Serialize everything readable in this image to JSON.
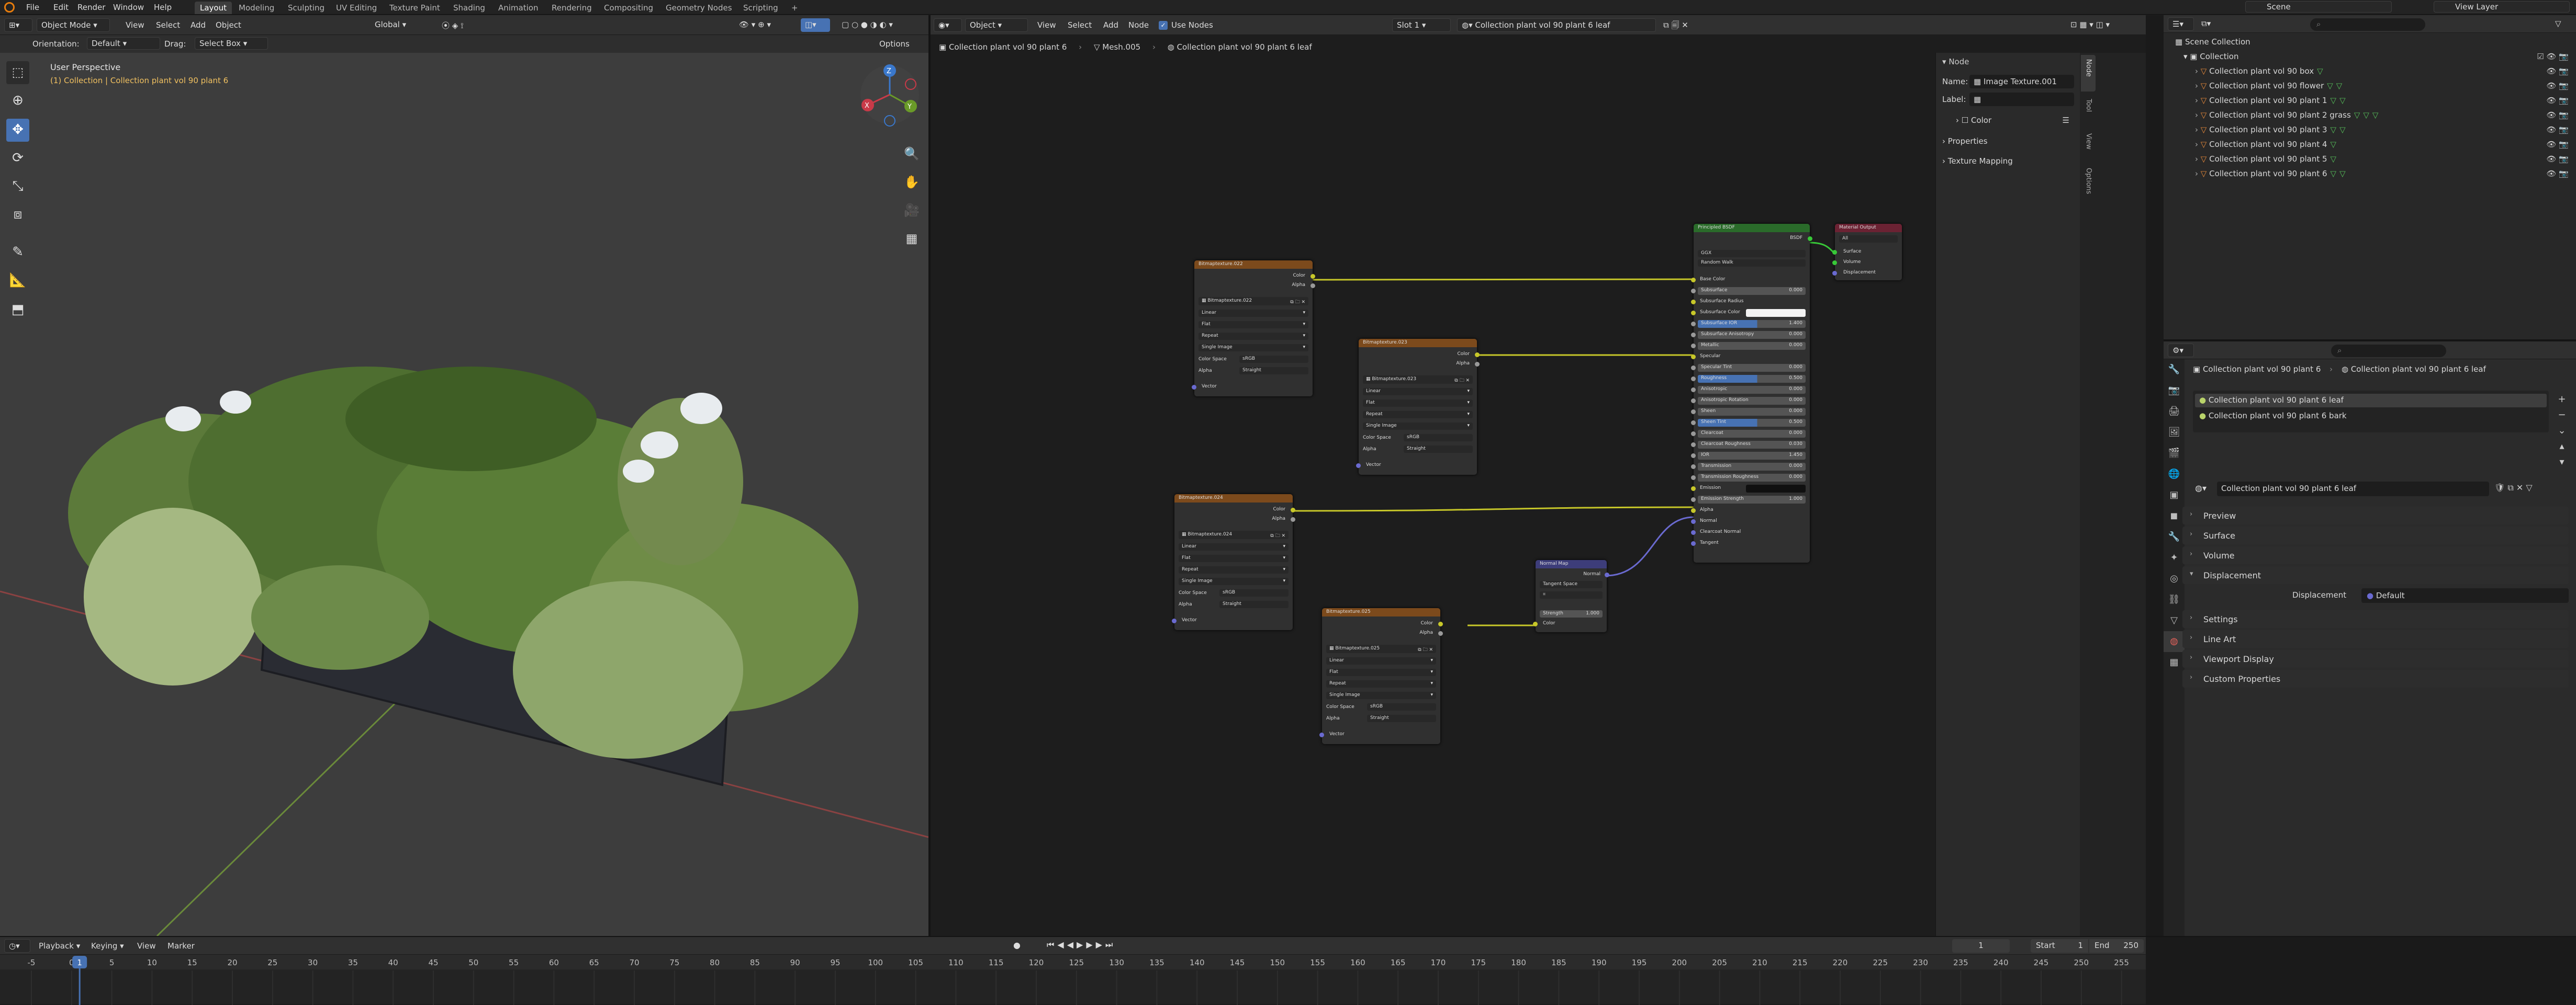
{
  "topbar": {
    "menu": [
      "File",
      "Edit",
      "Render",
      "Window",
      "Help"
    ],
    "workspaces": [
      "Layout",
      "Modeling",
      "Sculpting",
      "UV Editing",
      "Texture Paint",
      "Shading",
      "Animation",
      "Rendering",
      "Compositing",
      "Geometry Nodes",
      "Scripting"
    ],
    "active_workspace": "Layout",
    "add_tab": "+",
    "scene": "Scene",
    "view_layer": "View Layer"
  },
  "viewport": {
    "mode": "Object Mode",
    "menus": [
      "View",
      "Select",
      "Add",
      "Object"
    ],
    "orientation_label": "Orientation:",
    "orientation_value": "Default",
    "drag_label": "Drag:",
    "drag_value": "Select Box",
    "transform_orientation": "Global",
    "options": "Options",
    "overlay_title": "User Perspective",
    "overlay_subtitle": "(1) Collection | Collection plant vol 90 plant 6",
    "gizmo": {
      "x": "X",
      "y": "Y",
      "z": "Z"
    }
  },
  "node_editor": {
    "editor_mode": "Object",
    "menus": [
      "View",
      "Select",
      "Add",
      "Node"
    ],
    "use_nodes_label": "Use Nodes",
    "slot": "Slot 1",
    "material": "Collection plant vol 90 plant 6  leaf",
    "breadcrumb": [
      "Collection plant vol 90 plant 6",
      "Mesh.005",
      "Collection plant vol 90 plant 6  leaf"
    ],
    "image_nodes": [
      {
        "title": "Bitmaptexture.022",
        "image": "Bitmaptexture.022",
        "interp": "Linear",
        "proj": "Flat",
        "ext": "Repeat",
        "source": "Single Image",
        "colorspace_label": "Color Space",
        "colorspace": "sRGB",
        "alpha_label": "Alpha",
        "alpha": "Straight",
        "out_color": "Color",
        "out_alpha": "Alpha",
        "in_vector": "Vector"
      },
      {
        "title": "Bitmaptexture.023",
        "image": "Bitmaptexture.023",
        "interp": "Linear",
        "proj": "Flat",
        "ext": "Repeat",
        "source": "Single Image",
        "colorspace_label": "Color Space",
        "colorspace": "sRGB",
        "alpha_label": "Alpha",
        "alpha": "Straight",
        "out_color": "Color",
        "out_alpha": "Alpha",
        "in_vector": "Vector"
      },
      {
        "title": "Bitmaptexture.024",
        "image": "Bitmaptexture.024",
        "interp": "Linear",
        "proj": "Flat",
        "ext": "Repeat",
        "source": "Single Image",
        "colorspace_label": "Color Space",
        "colorspace": "sRGB",
        "alpha_label": "Alpha",
        "alpha": "Straight",
        "out_color": "Color",
        "out_alpha": "Alpha",
        "in_vector": "Vector"
      },
      {
        "title": "Bitmaptexture.025",
        "image": "Bitmaptexture.025",
        "interp": "Linear",
        "proj": "Flat",
        "ext": "Repeat",
        "source": "Single Image",
        "colorspace_label": "Color Space",
        "colorspace": "sRGB",
        "alpha_label": "Alpha",
        "alpha": "Straight",
        "out_color": "Color",
        "out_alpha": "Alpha",
        "in_vector": "Vector"
      }
    ],
    "normal_map": {
      "title": "Normal Map",
      "out": "Normal",
      "space": "Tangent Space",
      "uv": "",
      "strength_label": "Strength",
      "strength": "1.000",
      "in_color": "Color"
    },
    "bsdf": {
      "title": "Principled BSDF",
      "output": "BSDF",
      "dist": "GGX",
      "sss": "Random Walk",
      "rows": [
        {
          "label": "Base Color",
          "value": "",
          "kind": "plain"
        },
        {
          "label": "Subsurface",
          "value": "0.000",
          "kind": "field"
        },
        {
          "label": "Subsurface Radius",
          "value": "",
          "kind": "plain"
        },
        {
          "label": "Subsurface Color",
          "value": "",
          "kind": "swatch"
        },
        {
          "label": "Subsurface IOR",
          "value": "1.400",
          "kind": "blue"
        },
        {
          "label": "Subsurface Anisotropy",
          "value": "0.000",
          "kind": "field"
        },
        {
          "label": "Metallic",
          "value": "0.000",
          "kind": "field"
        },
        {
          "label": "Specular",
          "value": "",
          "kind": "plain"
        },
        {
          "label": "Specular Tint",
          "value": "0.000",
          "kind": "field"
        },
        {
          "label": "Roughness",
          "value": "0.500",
          "kind": "blue"
        },
        {
          "label": "Anisotropic",
          "value": "0.000",
          "kind": "field"
        },
        {
          "label": "Anisotropic Rotation",
          "value": "0.000",
          "kind": "field"
        },
        {
          "label": "Sheen",
          "value": "0.000",
          "kind": "field"
        },
        {
          "label": "Sheen Tint",
          "value": "0.500",
          "kind": "blue"
        },
        {
          "label": "Clearcoat",
          "value": "0.000",
          "kind": "field"
        },
        {
          "label": "Clearcoat Roughness",
          "value": "0.030",
          "kind": "field"
        },
        {
          "label": "IOR",
          "value": "1.450",
          "kind": "field"
        },
        {
          "label": "Transmission",
          "value": "0.000",
          "kind": "field"
        },
        {
          "label": "Transmission Roughness",
          "value": "0.000",
          "kind": "field"
        },
        {
          "label": "Emission",
          "value": "",
          "kind": "dark"
        },
        {
          "label": "Emission Strength",
          "value": "1.000",
          "kind": "field"
        },
        {
          "label": "Alpha",
          "value": "",
          "kind": "plain"
        },
        {
          "label": "Normal",
          "value": "",
          "kind": "plain"
        },
        {
          "label": "Clearcoat Normal",
          "value": "",
          "kind": "plain"
        },
        {
          "label": "Tangent",
          "value": "",
          "kind": "plain"
        }
      ]
    },
    "material_output": {
      "title": "Material Output",
      "target": "All",
      "in": [
        "Surface",
        "Volume",
        "Displacement"
      ]
    },
    "side_tabs": [
      "Node",
      "Tool",
      "View",
      "Options"
    ],
    "sidebar": {
      "section": "Node",
      "name_label": "Name:",
      "name_value": "Image Texture.001",
      "label_label": "Label:",
      "label_value": "",
      "color": "Color",
      "properties": "Properties",
      "texture_mapping": "Texture Mapping"
    }
  },
  "outliner": {
    "root": "Scene Collection",
    "collection": "Collection",
    "items": [
      "Collection plant vol 90 box",
      "Collection plant vol 90 flower",
      "Collection plant vol 90 plant 1",
      "Collection plant vol 90 plant 2 grass",
      "Collection plant vol 90 plant 3",
      "Collection plant vol 90 plant 4",
      "Collection plant vol 90 plant 5",
      "Collection plant vol 90 plant 6"
    ]
  },
  "properties": {
    "breadcrumb_object": "Collection plant vol 90 plant 6",
    "breadcrumb_material": "Collection plant vol 90 plant 6  leaf",
    "slots": [
      "Collection plant vol 90 plant 6  leaf",
      "Collection plant vol 90 plant 6  bark"
    ],
    "material_name": "Collection plant vol 90 plant 6  leaf",
    "panels": [
      "Preview",
      "Surface",
      "Volume",
      "Displacement",
      "Settings",
      "Line Art",
      "Viewport Display",
      "Custom Properties"
    ],
    "displacement_label": "Displacement",
    "displacement_value": "Default"
  },
  "timeline": {
    "menus": [
      "Playback",
      "Keying",
      "View",
      "Marker"
    ],
    "current_frame": "1",
    "start_label": "Start",
    "start": "1",
    "end_label": "End",
    "end": "250",
    "ticks": [
      "-5",
      "0",
      "5",
      "10",
      "15",
      "20",
      "25",
      "30",
      "35",
      "40",
      "45",
      "50",
      "55",
      "60",
      "65",
      "70",
      "75",
      "80",
      "85",
      "90",
      "95",
      "100",
      "105",
      "110",
      "115",
      "120",
      "125",
      "130",
      "135",
      "140",
      "145",
      "150",
      "155",
      "160",
      "165",
      "170",
      "175",
      "180",
      "185",
      "190",
      "195",
      "200",
      "205",
      "210",
      "215",
      "220",
      "225",
      "230",
      "235",
      "240",
      "245",
      "250",
      "255"
    ],
    "playhead": "1"
  },
  "colors": {
    "accent": "#4772b3",
    "image_header": "#7c4a1c",
    "bsdf_header": "#2a6b2a",
    "output_header": "#6b2233",
    "normal_header": "#3d3d7a",
    "link_yellow": "#c7c729",
    "link_purple": "#6a6ad0"
  }
}
